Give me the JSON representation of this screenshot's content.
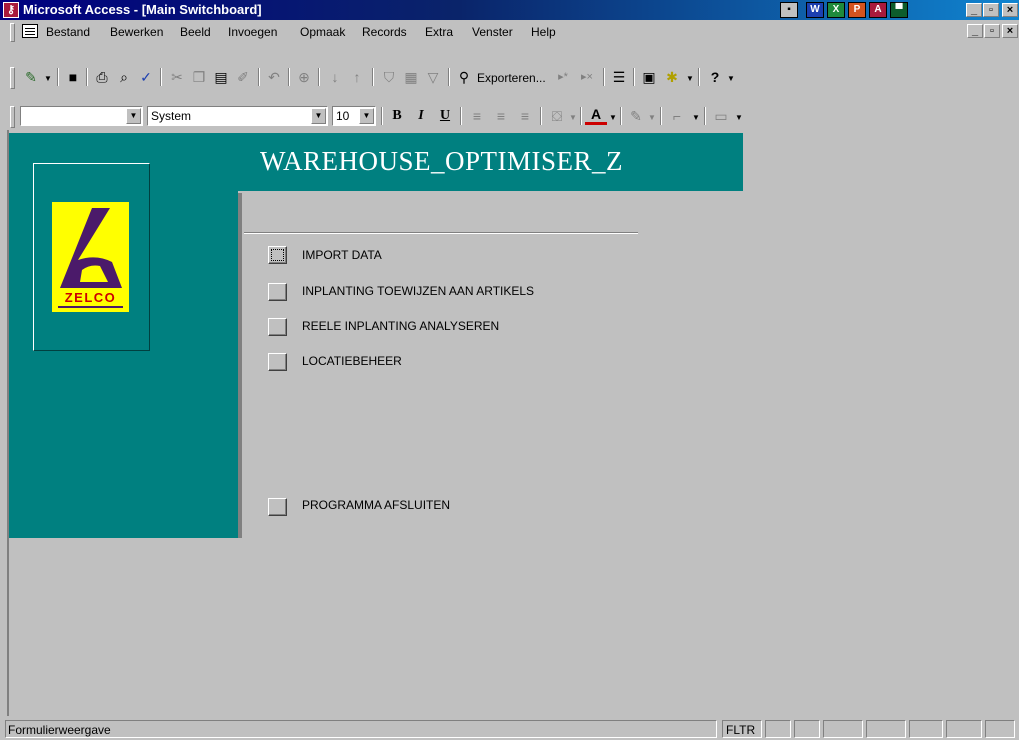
{
  "window": {
    "title": "Microsoft Access - [Main Switchboard]",
    "app_icon": "access-key-icon",
    "tray_icons": [
      "office-shortcut-icon",
      "word-icon",
      "excel-icon",
      "powerpoint-icon",
      "access-icon",
      "outlook-icon"
    ],
    "controls": {
      "minimize": "_",
      "maximize": "▫",
      "close": "×"
    }
  },
  "menubar": {
    "items": [
      "Bestand",
      "Bewerken",
      "Beeld",
      "Invoegen",
      "Opmaak",
      "Records",
      "Extra",
      "Venster",
      "Help"
    ],
    "mdi_controls": {
      "minimize": "_",
      "restore": "▫",
      "close": "×"
    }
  },
  "toolbar1": {
    "buttons": [
      {
        "name": "design-view-icon",
        "glyph": "✎"
      },
      {
        "name": "save-icon",
        "glyph": "■"
      },
      {
        "name": "print-icon",
        "glyph": "⎙"
      },
      {
        "name": "print-preview-icon",
        "glyph": "⌕"
      },
      {
        "name": "spelling-icon",
        "glyph": "✓"
      },
      {
        "name": "cut-icon",
        "glyph": "✂"
      },
      {
        "name": "copy-icon",
        "glyph": "❐"
      },
      {
        "name": "paste-icon",
        "glyph": "▤"
      },
      {
        "name": "format-painter-icon",
        "glyph": "✐"
      },
      {
        "name": "undo-icon",
        "glyph": "↶"
      },
      {
        "name": "insert-hyperlink-icon",
        "glyph": "⊕"
      },
      {
        "name": "sort-ascending-icon",
        "glyph": "↓"
      },
      {
        "name": "sort-descending-icon",
        "glyph": "↑"
      },
      {
        "name": "filter-by-selection-icon",
        "glyph": "⛉"
      },
      {
        "name": "filter-by-form-icon",
        "glyph": "▦"
      },
      {
        "name": "apply-filter-icon",
        "glyph": "▽"
      },
      {
        "name": "find-icon",
        "glyph": "⚲"
      }
    ],
    "export_label": "Exporteren...",
    "buttons2": [
      {
        "name": "new-record-icon",
        "glyph": "▸*"
      },
      {
        "name": "delete-record-icon",
        "glyph": "▸×"
      },
      {
        "name": "properties-icon",
        "glyph": "☰"
      },
      {
        "name": "database-window-icon",
        "glyph": "▣"
      },
      {
        "name": "new-object-icon",
        "glyph": "✱"
      },
      {
        "name": "help-icon",
        "glyph": "?"
      }
    ]
  },
  "toolbar2": {
    "object_combo": "",
    "font_combo": "System",
    "size_combo": "10",
    "bold": "B",
    "italic": "I",
    "underline": "U",
    "align_icons": [
      "align-left-icon",
      "align-center-icon",
      "align-right-icon"
    ],
    "fill_color_icon": "fill-color-icon",
    "font_color_label": "A",
    "line_color_icon": "line-color-icon",
    "border_icon": "border-icon",
    "line_width_icon": "line-width-icon"
  },
  "form": {
    "title": "WAREHOUSE_OPTIMISER_Z",
    "logo_text": "ZELCO",
    "colors": {
      "panel": "#008080",
      "logo_yellow": "#ffff00",
      "logo_purple": "#4b1a6a",
      "logo_red": "#cc0000"
    },
    "items": [
      {
        "label": "IMPORT DATA",
        "focused": true
      },
      {
        "label": "INPLANTING TOEWIJZEN AAN ARTIKELS",
        "focused": false
      },
      {
        "label": "REELE INPLANTING ANALYSEREN",
        "focused": false
      },
      {
        "label": "LOCATIEBEHEER",
        "focused": false
      }
    ],
    "exit_item": {
      "label": "PROGRAMMA AFSLUITEN"
    }
  },
  "statusbar": {
    "text": "Formulierweergave",
    "indicator": "FLTR"
  }
}
